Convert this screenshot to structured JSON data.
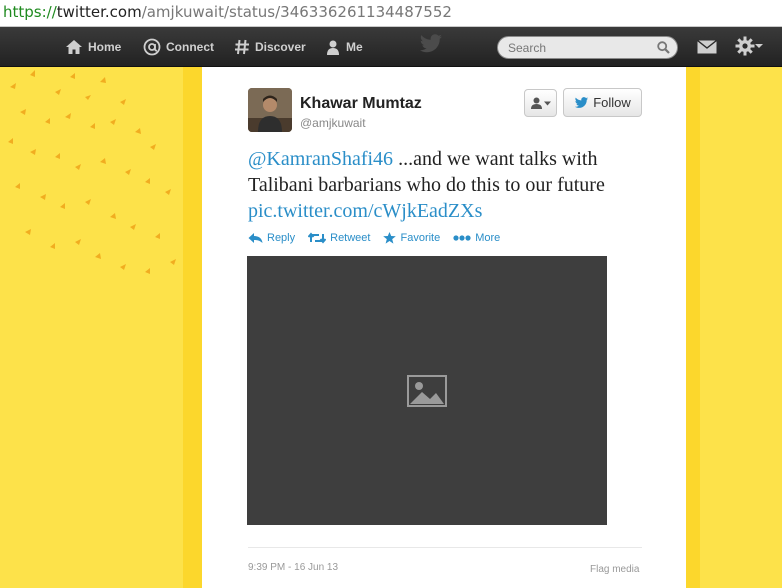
{
  "browser": {
    "url_scheme": "https://",
    "url_host": "twitter.com",
    "url_path": "/amjkuwait/status/346336261134487552"
  },
  "nav": {
    "home": "Home",
    "connect": "Connect",
    "discover": "Discover",
    "me": "Me",
    "search_placeholder": "Search"
  },
  "tweet": {
    "fullname": "Khawar Mumtaz",
    "handle": "@amjkuwait",
    "follow_label": "Follow",
    "mention": "@KamranShafi46",
    "text": " ...and we want talks with Talibani barbarians who do this to our future ",
    "link": "pic.twitter.com/cWjkEadZXs",
    "actions": {
      "reply": "Reply",
      "retweet": "Retweet",
      "favorite": "Favorite",
      "more": "More"
    },
    "timestamp": "9:39 PM - 16 Jun 13",
    "flag_media": "Flag media"
  },
  "colors": {
    "accent": "#2a8ec8",
    "background": "#fde24a",
    "topbar": "#2b2b2b"
  }
}
